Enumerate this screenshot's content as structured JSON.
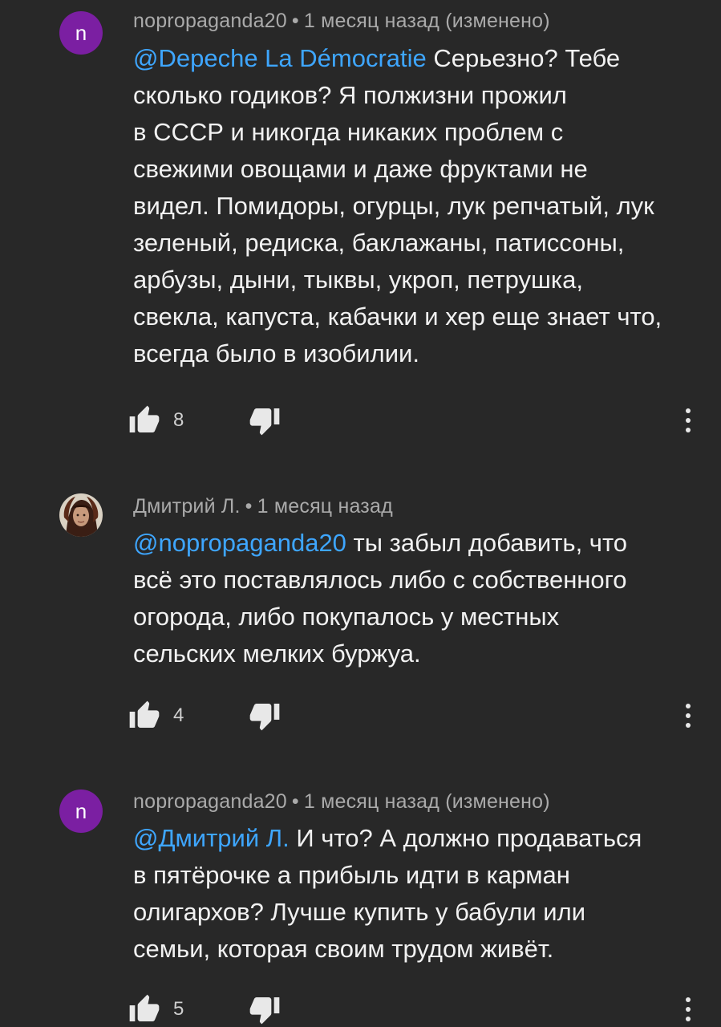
{
  "comments": [
    {
      "author": "nopropaganda20",
      "avatar_letter": "n",
      "avatar_color": "#7b1fa2",
      "separator": "•",
      "time": "1 месяц назад (изменено)",
      "mention": "@Depeche La Démocratie",
      "lines": [
        " Серьезно? Тебе",
        "сколько годиков? Я полжизни прожил",
        "в СССР и никогда никаких проблем с",
        "свежими овощами и даже фруктами не",
        "видел. Помидоры, огурцы, лук репчатый, лук",
        "зеленый, редиска, баклажаны, патиссоны,",
        "арбузы, дыни, тыквы, укроп, петрушка,",
        "свекла, капуста, кабачки и хер еще знает что,",
        "всегда было в изобилии."
      ],
      "likes": "8",
      "icons": {
        "like": "thumbs-up-icon",
        "dislike": "thumbs-down-icon",
        "more": "more-vert-icon"
      }
    },
    {
      "author": "Дмитрий Л.",
      "avatar_letter": "",
      "separator": "•",
      "time": "1 месяц назад",
      "mention": "@nopropaganda20",
      "lines": [
        " ты забыл добавить, что",
        "всё это поставлялось либо с собственного",
        "огорода, либо покупалось у местных",
        "сельских мелких буржуа."
      ],
      "likes": "4",
      "icons": {
        "like": "thumbs-up-icon",
        "dislike": "thumbs-down-icon",
        "more": "more-vert-icon"
      }
    },
    {
      "author": "nopropaganda20",
      "avatar_letter": "n",
      "avatar_color": "#7b1fa2",
      "separator": "•",
      "time": "1 месяц назад (изменено)",
      "mention": "@Дмитрий Л.",
      "lines": [
        " И что? А должно продаваться",
        "в пятёрочке а прибыль идти в  карман",
        "олигархов? Лучше купить у бабули или",
        "семьи, которая своим трудом живёт."
      ],
      "likes": "5",
      "icons": {
        "like": "thumbs-up-icon",
        "dislike": "thumbs-down-icon",
        "more": "more-vert-icon"
      }
    }
  ],
  "colors": {
    "background": "#282828",
    "mention": "#3ea6ff",
    "meta_text": "#aaaaaa",
    "body_text": "#f1f1f1"
  }
}
